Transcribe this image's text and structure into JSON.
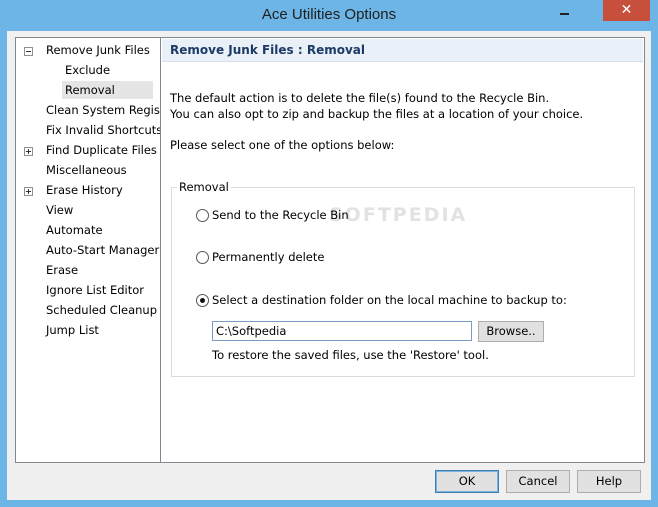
{
  "window": {
    "title": "Ace Utilities Options",
    "close_glyph": "✕"
  },
  "tree": {
    "items": [
      {
        "label": "Remove Junk Files",
        "expander": "minus"
      },
      {
        "label": "Exclude"
      },
      {
        "label": "Removal",
        "selected": true
      },
      {
        "label": "Clean System Registry"
      },
      {
        "label": "Fix Invalid Shortcuts"
      },
      {
        "label": "Find Duplicate Files",
        "expander": "plus"
      },
      {
        "label": "Miscellaneous"
      },
      {
        "label": "Erase History",
        "expander": "plus"
      },
      {
        "label": "View"
      },
      {
        "label": "Automate"
      },
      {
        "label": "Auto-Start Manager"
      },
      {
        "label": "Erase"
      },
      {
        "label": "Ignore List Editor"
      },
      {
        "label": "Scheduled Cleanup"
      },
      {
        "label": "Jump List"
      }
    ]
  },
  "panel": {
    "title": "Remove Junk Files : Removal",
    "desc_line1": "The default action is to delete the file(s) found to the Recycle Bin.",
    "desc_line2": "You can also opt to zip and backup the files at a location of your choice.",
    "prompt": "Please select one of the options below:",
    "group_label": "Removal",
    "options": [
      {
        "label": "Send to the Recycle Bin",
        "checked": false
      },
      {
        "label": "Permanently delete",
        "checked": false
      },
      {
        "label": "Select a destination folder on the local machine to backup to:",
        "checked": true
      }
    ],
    "backup_path": "C:\\Softpedia",
    "browse_label": "Browse..",
    "restore_hint": "To restore the saved files, use the 'Restore' tool.",
    "watermark": "SOFTPEDIA"
  },
  "buttons": {
    "ok": "OK",
    "cancel": "Cancel",
    "help": "Help"
  }
}
